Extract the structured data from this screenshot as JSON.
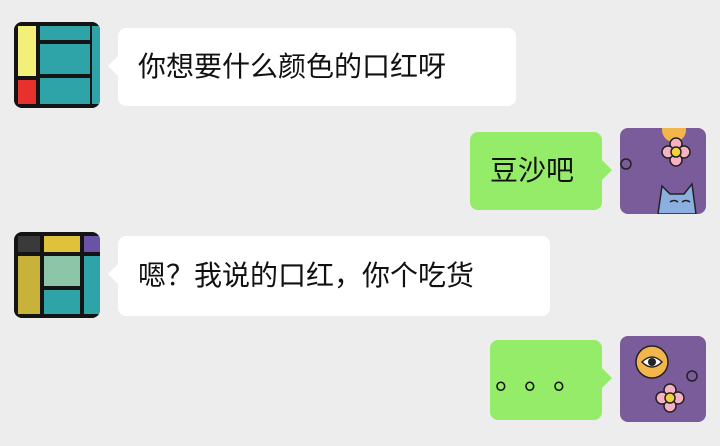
{
  "colors": {
    "background": "#ededed",
    "bubble_left": "#ffffff",
    "bubble_right": "#95ec69"
  },
  "messages": [
    {
      "side": "left",
      "text": "你想要什么颜色的口红呀",
      "avatar": "mondrian-avatar"
    },
    {
      "side": "right",
      "text": "豆沙吧",
      "avatar": "purple-cat-flower-avatar"
    },
    {
      "side": "left",
      "text": "嗯？我说的口红，你个吃货",
      "avatar": "mondrian-avatar"
    },
    {
      "side": "right",
      "text": "。。。",
      "avatar": "purple-eye-flower-avatar"
    }
  ]
}
